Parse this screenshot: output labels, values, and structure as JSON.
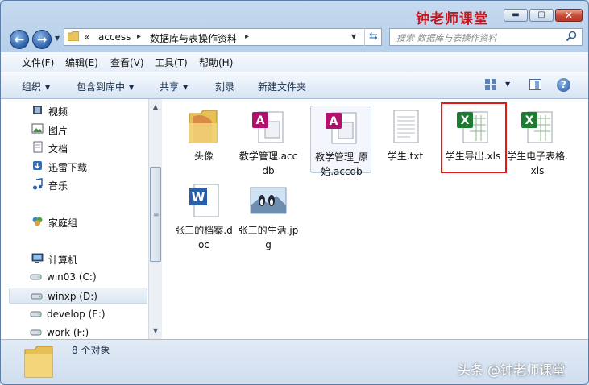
{
  "window": {
    "brand": "钟老师课堂",
    "controls": {
      "minimize": "▬",
      "maximize": "▢",
      "close": "✕"
    }
  },
  "nav": {
    "back_icon": "arrow-left",
    "forward_icon": "arrow-right",
    "breadcrumb": {
      "overflow": "«",
      "items": [
        "access",
        "数据库与表操作资料"
      ]
    },
    "search_placeholder": "搜索 数据库与表操作资料"
  },
  "menubar": [
    "文件(F)",
    "编辑(E)",
    "查看(V)",
    "工具(T)",
    "帮助(H)"
  ],
  "commandbar": [
    "组织",
    "包含到库中",
    "共享",
    "刻录",
    "新建文件夹"
  ],
  "sidebar": {
    "items": [
      {
        "label": "视频",
        "icon": "video-icon"
      },
      {
        "label": "图片",
        "icon": "pictures-icon"
      },
      {
        "label": "文档",
        "icon": "documents-icon"
      },
      {
        "label": "迅雷下载",
        "icon": "download-icon"
      },
      {
        "label": "音乐",
        "icon": "music-icon"
      },
      {
        "label": "家庭组",
        "icon": "homegroup-icon"
      },
      {
        "label": "计算机",
        "icon": "computer-icon"
      },
      {
        "label": "win03 (C:)",
        "icon": "drive-icon"
      },
      {
        "label": "winxp (D:)",
        "icon": "drive-icon",
        "selected": true
      },
      {
        "label": "develop (E:)",
        "icon": "drive-icon"
      },
      {
        "label": "work (F:)",
        "icon": "drive-icon"
      }
    ]
  },
  "files": [
    {
      "name": "头像",
      "type": "folder"
    },
    {
      "name": "教学管理.accdb",
      "type": "access"
    },
    {
      "name": "教学管理_原始.accdb",
      "type": "access",
      "highlighted": true
    },
    {
      "name": "学生.txt",
      "type": "text"
    },
    {
      "name": "学生导出.xls",
      "type": "excel",
      "boxed": true
    },
    {
      "name": "学生电子表格.xls",
      "type": "excel"
    },
    {
      "name": "张三的档案.doc",
      "type": "word"
    },
    {
      "name": "张三的生活.jpg",
      "type": "image"
    }
  ],
  "status": {
    "count": "8 个对象"
  },
  "watermark": "头条 @钟老师课堂",
  "colors": {
    "brand_red": "#c0171b",
    "highlight_box": "#e0191b",
    "excel_green": "#1f7a33",
    "access_magenta": "#b0116a"
  }
}
